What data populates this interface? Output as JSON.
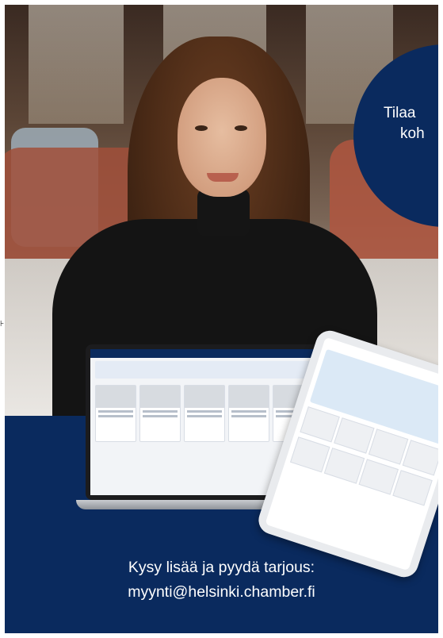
{
  "circle": {
    "line1": "Tilaa",
    "line2": "koh"
  },
  "side_mark": "⊦",
  "cta": {
    "line1": "Kysy lisää ja pyydä tarjous:",
    "email": "myynti@helsinki.chamber.fi"
  },
  "colors": {
    "navy": "#0a2a5e",
    "text": "#ffffff"
  }
}
